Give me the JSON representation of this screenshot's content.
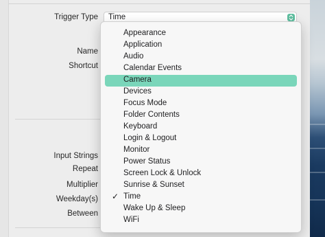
{
  "form": {
    "trigger_type_label": "Trigger Type",
    "trigger_type_value": "Time",
    "name_label": "Name",
    "shortcut_label": "Shortcut",
    "input_strings_label": "Input Strings",
    "repeat_label": "Repeat",
    "multiplier_label": "Multiplier",
    "weekdays_label": "Weekday(s)",
    "between_label": "Between"
  },
  "menu": {
    "items": [
      {
        "label": "Appearance"
      },
      {
        "label": "Application"
      },
      {
        "label": "Audio"
      },
      {
        "label": "Calendar Events"
      },
      {
        "label": "Camera",
        "highlighted": true
      },
      {
        "label": "Devices"
      },
      {
        "label": "Focus Mode"
      },
      {
        "label": "Folder Contents"
      },
      {
        "label": "Keyboard"
      },
      {
        "label": "Login & Logout"
      },
      {
        "label": "Monitor"
      },
      {
        "label": "Power Status"
      },
      {
        "label": "Screen Lock & Unlock"
      },
      {
        "label": "Sunrise & Sunset"
      },
      {
        "label": "Time",
        "checked": true
      },
      {
        "label": "Wake Up & Sleep"
      },
      {
        "label": "WiFi"
      }
    ],
    "check_glyph": "✓"
  },
  "colors": {
    "highlight": "#7ad6ba",
    "accent": "#5fbfa0"
  }
}
